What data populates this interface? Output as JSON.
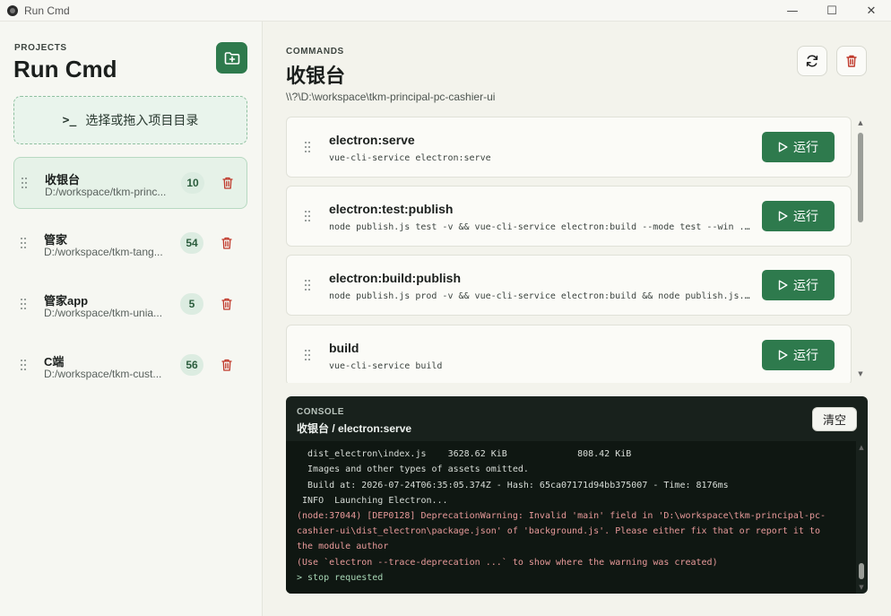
{
  "window": {
    "title": "Run Cmd",
    "controls": {
      "minimize": "—",
      "maximize": "☐",
      "close": "✕"
    }
  },
  "sidebar": {
    "kicker": "PROJECTS",
    "title": "Run Cmd",
    "dropzone": {
      "prompt": ">_",
      "label": "选择或拖入项目目录"
    },
    "projects": [
      {
        "name": "收银台",
        "path": "D:/workspace/tkm-princ...",
        "count": "10",
        "active": true
      },
      {
        "name": "管家",
        "path": "D:/workspace/tkm-tang...",
        "count": "54",
        "active": false
      },
      {
        "name": "管家app",
        "path": "D:/workspace/tkm-unia...",
        "count": "5",
        "active": false
      },
      {
        "name": "C端",
        "path": "D:/workspace/tkm-cust...",
        "count": "56",
        "active": false
      }
    ]
  },
  "main": {
    "kicker": "COMMANDS",
    "title": "收银台",
    "path": "\\\\?\\D:\\workspace\\tkm-principal-pc-cashier-ui",
    "run_label": "运行",
    "commands": [
      {
        "name": "electron:serve",
        "line": "vue-cli-service electron:serve"
      },
      {
        "name": "electron:test:publish",
        "line": "node publish.js test -v && vue-cli-service electron:build --mode test --win ..."
      },
      {
        "name": "electron:build:publish",
        "line": "node publish.js prod -v && vue-cli-service electron:build && node publish.js..."
      },
      {
        "name": "build",
        "line": "vue-cli-service build"
      }
    ]
  },
  "console": {
    "kicker": "CONSOLE",
    "title": "收银台 / electron:serve",
    "clear_label": "清空",
    "lines": [
      {
        "text": "  dist_electron\\index.js    3628.62 KiB             808.42 KiB",
        "kind": "normal"
      },
      {
        "text": "  Images and other types of assets omitted.",
        "kind": "normal"
      },
      {
        "text": "  Build at: 2026-07-24T06:35:05.374Z - Hash: 65ca07171d94bb375007 - Time: 8176ms",
        "kind": "normal"
      },
      {
        "text": " INFO  Launching Electron...",
        "kind": "normal"
      },
      {
        "text": "(node:37044) [DEP0128] DeprecationWarning: Invalid 'main' field in 'D:\\workspace\\tkm-principal-pc-",
        "kind": "warn"
      },
      {
        "text": "cashier-ui\\dist_electron\\package.json' of 'background.js'. Please either fix that or report it to",
        "kind": "warn"
      },
      {
        "text": "the module author",
        "kind": "warn"
      },
      {
        "text": "(Use `electron --trace-deprecation ...` to show where the warning was created)",
        "kind": "warn"
      },
      {
        "text": "> stop requested",
        "kind": "ok"
      }
    ]
  },
  "colors": {
    "accent": "#2e7a4d",
    "danger": "#c0392b",
    "console_bg": "#18211c"
  },
  "icons": {
    "add_folder": "folder-plus-icon",
    "refresh": "refresh-icon",
    "delete": "trash-icon",
    "run": "play-icon",
    "drag": "grip-icon"
  }
}
